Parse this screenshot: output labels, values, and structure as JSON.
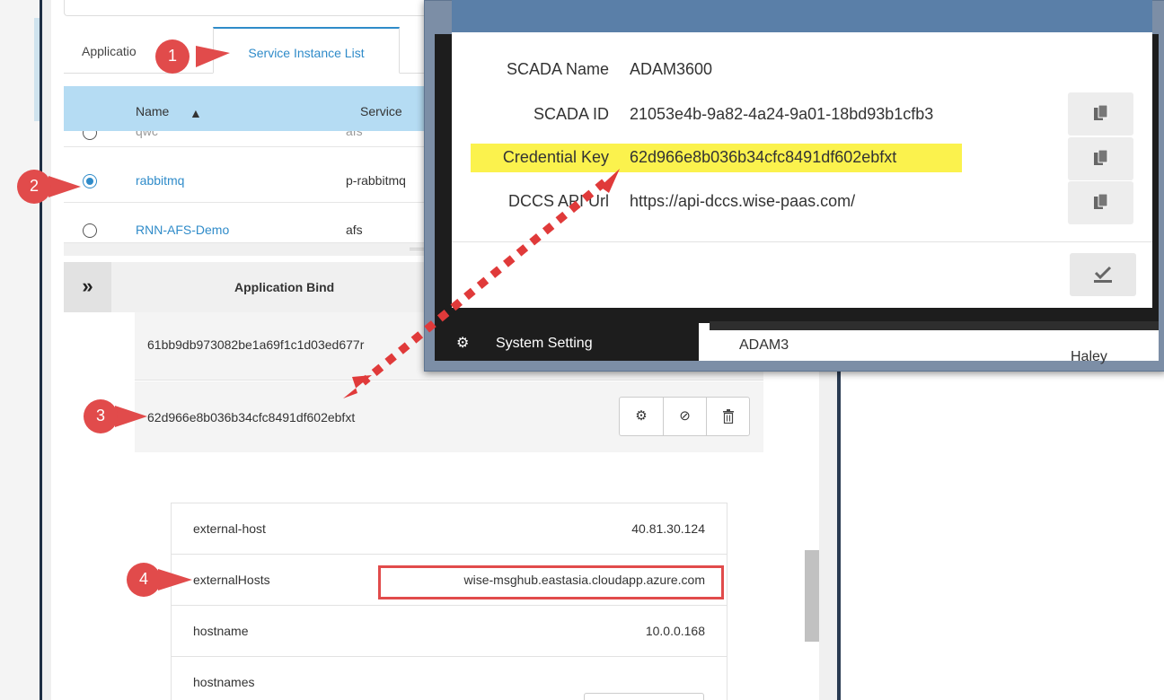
{
  "tabs": {
    "application": "Applicatio",
    "service_instance_list": "Service Instance List"
  },
  "table": {
    "headers": {
      "name": "Name",
      "sort": "▲",
      "service": "Service"
    },
    "rows": [
      {
        "name": "qwc",
        "service": "afs",
        "selected": false
      },
      {
        "name": "rabbitmq",
        "service": "p-rabbitmq",
        "selected": true
      },
      {
        "name": "RNN-AFS-Demo",
        "service": "afs",
        "selected": false
      }
    ]
  },
  "bind": {
    "title": "Application Bind",
    "collapse_icon": "double-chevron-down-icon",
    "items": [
      {
        "key": "61bb9db973082be1a69f1c1d03ed677r"
      },
      {
        "key": "62d966e8b036b34cfc8491df602ebfxt"
      }
    ],
    "actions": [
      "gear-icon",
      "ban-icon",
      "trash-icon"
    ]
  },
  "credentials": {
    "rows": [
      {
        "key": "external-host",
        "value": "40.81.30.124"
      },
      {
        "key": "externalHosts",
        "value": "wise-msghub.eastasia.cloudapp.azure.com"
      },
      {
        "key": "hostname",
        "value": "10.0.0.168"
      },
      {
        "key": "hostnames",
        "value": ""
      }
    ]
  },
  "dialog": {
    "fields": {
      "scada_name": {
        "label": "SCADA Name",
        "value": "ADAM3600"
      },
      "scada_id": {
        "label": "SCADA ID",
        "value": "21053e4b-9a82-4a24-9a01-18bd93b1cfb3"
      },
      "credential_key": {
        "label": "Credential Key",
        "value": "62d966e8b036b34cfc8491df602ebfxt"
      },
      "dccs_api_url": {
        "label": "DCCS API Url",
        "value": "https://api-dccs.wise-paas.com/"
      }
    }
  },
  "background": {
    "menu_item": "System Setting",
    "panel_text": "ADAM3",
    "panel_text2": "Haley"
  },
  "callouts": [
    "1",
    "2",
    "3",
    "4"
  ],
  "colors": {
    "accent": "#2f8bc9",
    "callout_red": "#e14b4b",
    "highlight_yellow": "#fbf24d",
    "dialog_header": "#5a7fa8"
  }
}
